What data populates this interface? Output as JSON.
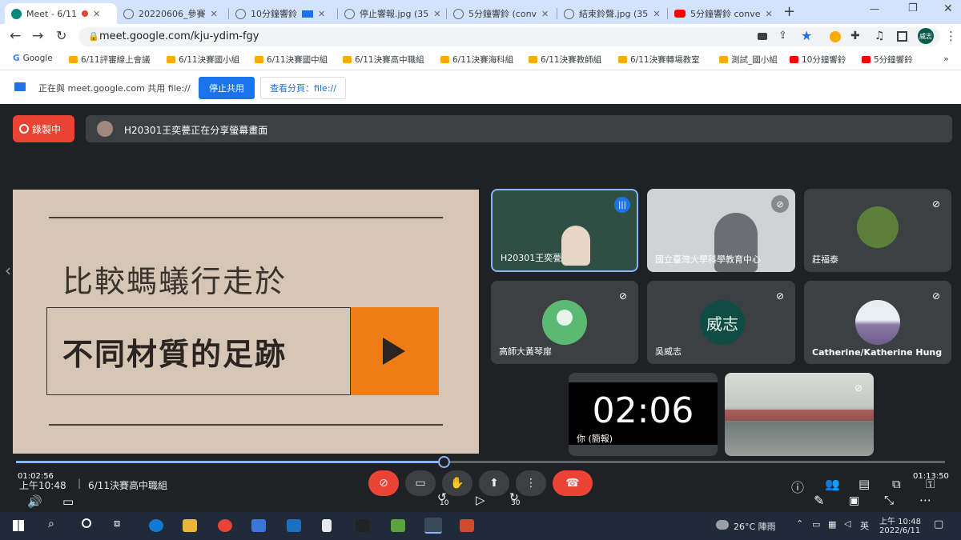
{
  "tabs": [
    {
      "label": "Meet - 6/11",
      "active": true,
      "recording": true
    },
    {
      "label": "20220606_參賽",
      "active": false
    },
    {
      "label": "10分鐘響鈴",
      "active": false
    },
    {
      "label": "停止響報.jpg (35",
      "active": false
    },
    {
      "label": "5分鐘響鈴 (conv",
      "active": false
    },
    {
      "label": "結束鈴聲.jpg (35",
      "active": false
    },
    {
      "label": "5分鐘響鈴 conve",
      "active": false
    }
  ],
  "address": {
    "url": "meet.google.com/kju-ydim-fgy"
  },
  "profile_badge": "威志",
  "bookmarks": [
    {
      "label": "Google",
      "icon": "google"
    },
    {
      "label": "6/11評審線上會議",
      "icon": "meet"
    },
    {
      "label": "6/11決賽國小組",
      "icon": "meet"
    },
    {
      "label": "6/11決賽國中組",
      "icon": "meet"
    },
    {
      "label": "6/11決賽高中職組",
      "icon": "meet"
    },
    {
      "label": "6/11決賽海科組",
      "icon": "meet"
    },
    {
      "label": "6/11決賽教師組",
      "icon": "meet"
    },
    {
      "label": "6/11決賽轉場教室",
      "icon": "meet"
    },
    {
      "label": "測試_國小組",
      "icon": "meet"
    },
    {
      "label": "10分鐘響鈴",
      "icon": "youtube"
    },
    {
      "label": "5分鐘響鈴",
      "icon": "youtube"
    }
  ],
  "sharebar": {
    "message": "正在與 meet.google.com 共用 file://",
    "stop_label": "停止共用",
    "view_label": "查看分頁：file://"
  },
  "meet": {
    "recording_label": "錄製中",
    "presenter_message": "H20301王奕甍正在分享螢幕畫面",
    "slide": {
      "title_line1": "比較螞蟻行走於",
      "title_line2": "不同材質的足跡"
    },
    "tiles": [
      {
        "name": "H20301王奕甍",
        "speaking": true
      },
      {
        "name": "國立臺灣大學科學教育中心",
        "muted": true
      },
      {
        "name": "莊福泰",
        "muted": true
      },
      {
        "name": "高師大黃琴扉",
        "muted": true
      },
      {
        "name": "吳威志",
        "initials": "威志",
        "muted": true
      },
      {
        "name": "Catherine/Katherine Hung",
        "muted": true
      },
      {
        "name": "你 (簡報)",
        "timer": "02:06"
      },
      {
        "name": "",
        "muted": true
      }
    ]
  },
  "player": {
    "elapsed": "01:02:56",
    "total": "01:13:50",
    "progress": 0.46,
    "clock": "上午10:48",
    "meeting_name": "6/11決賽高中職組",
    "rewind_label": "10",
    "forward_label": "30"
  },
  "taskbar": {
    "weather": "26°C  陣雨",
    "ime": "英",
    "time": "上午 10:48",
    "date": "2022/6/11"
  }
}
